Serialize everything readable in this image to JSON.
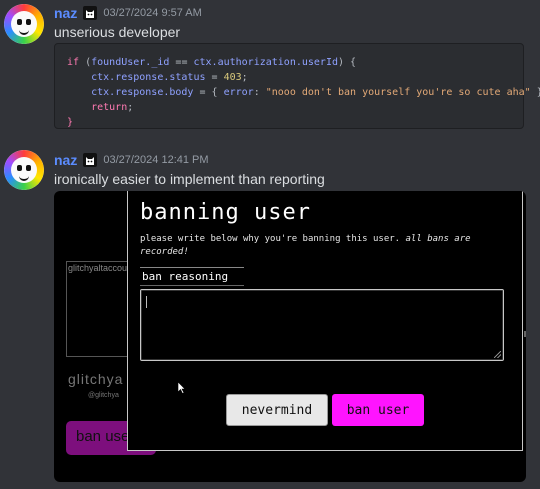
{
  "messages": [
    {
      "username": "naz",
      "timestamp": "03/27/2024 9:57 AM",
      "text": "unserious developer",
      "code_lines": [
        "if (foundUser._id == ctx.authorization.userId) {",
        "    ctx.response.status = 403;",
        "    ctx.response.body = { error: \"nooo don't ban yourself you're so cute aha\" };",
        "    return;",
        "}"
      ]
    },
    {
      "username": "naz",
      "timestamp": "03/27/2024 12:41 PM",
      "text": "ironically easier to implement than reporting"
    }
  ],
  "embed": {
    "background": {
      "image_alt": "glitchyaltaccount profile picture",
      "name": "glitchya",
      "sub": "@glitchya",
      "button": "ban user"
    },
    "modal": {
      "title": "banning user",
      "description": "please write below why you're banning this user.",
      "description_emphasis": "all bans are recorded!",
      "field_label": "ban reasoning",
      "textarea_value": "",
      "nevermind_label": "nevermind",
      "ban_label": "ban user"
    }
  },
  "colors": {
    "username": "#5b8cff",
    "ban_button": "#ff14ff",
    "background": "#313338"
  }
}
